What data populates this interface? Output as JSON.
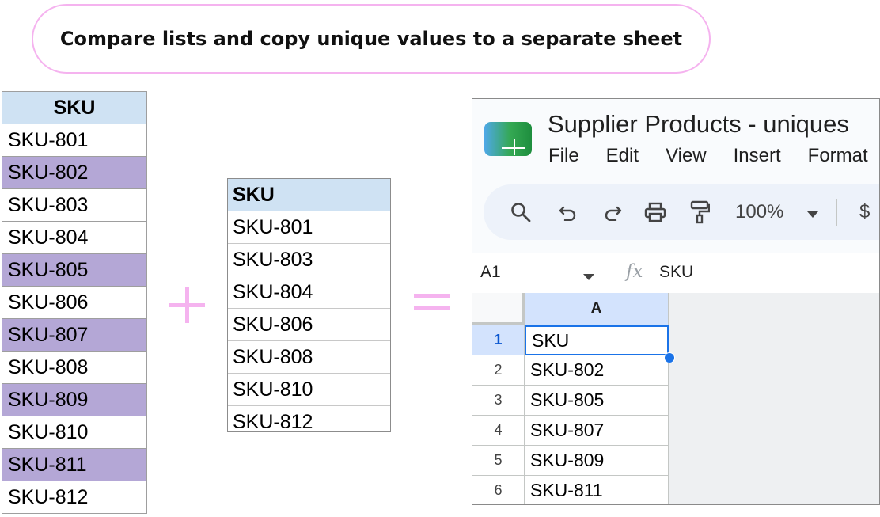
{
  "banner": {
    "text": "Compare lists and copy unique values to a separate sheet"
  },
  "list1": {
    "header": "SKU",
    "rows": [
      {
        "value": "SKU-801",
        "highlighted": false
      },
      {
        "value": "SKU-802",
        "highlighted": true
      },
      {
        "value": "SKU-803",
        "highlighted": false
      },
      {
        "value": "SKU-804",
        "highlighted": false
      },
      {
        "value": "SKU-805",
        "highlighted": true
      },
      {
        "value": "SKU-806",
        "highlighted": false
      },
      {
        "value": "SKU-807",
        "highlighted": true
      },
      {
        "value": "SKU-808",
        "highlighted": false
      },
      {
        "value": "SKU-809",
        "highlighted": true
      },
      {
        "value": "SKU-810",
        "highlighted": false
      },
      {
        "value": "SKU-811",
        "highlighted": true
      },
      {
        "value": "SKU-812",
        "highlighted": false
      }
    ]
  },
  "list2": {
    "header": "SKU",
    "rows": [
      "SKU-801",
      "SKU-803",
      "SKU-804",
      "SKU-806",
      "SKU-808",
      "SKU-810",
      "SKU-812"
    ]
  },
  "operators": {
    "plus": "plus-icon",
    "equals": "equals-icon"
  },
  "sheets": {
    "title": "Supplier Products - uniques",
    "menu": [
      "File",
      "Edit",
      "View",
      "Insert",
      "Format"
    ],
    "toolbar": {
      "icons": [
        "search-icon",
        "undo-icon",
        "redo-icon",
        "print-icon",
        "paint-format-icon"
      ],
      "zoom": "100%",
      "currency": "$"
    },
    "formula_bar": {
      "name_box": "A1",
      "fx": "fx",
      "value": "SKU"
    },
    "grid": {
      "column": "A",
      "rows": [
        {
          "num": "1",
          "value": "SKU"
        },
        {
          "num": "2",
          "value": "SKU-802"
        },
        {
          "num": "3",
          "value": "SKU-805"
        },
        {
          "num": "4",
          "value": "SKU-807"
        },
        {
          "num": "5",
          "value": "SKU-809"
        },
        {
          "num": "6",
          "value": "SKU-811"
        }
      ]
    }
  },
  "colors": {
    "header_fill": "#cfe2f3",
    "highlight_fill": "#b4a7d6",
    "accent_pink": "#f5b3ef",
    "selection_blue": "#1a73e8"
  }
}
